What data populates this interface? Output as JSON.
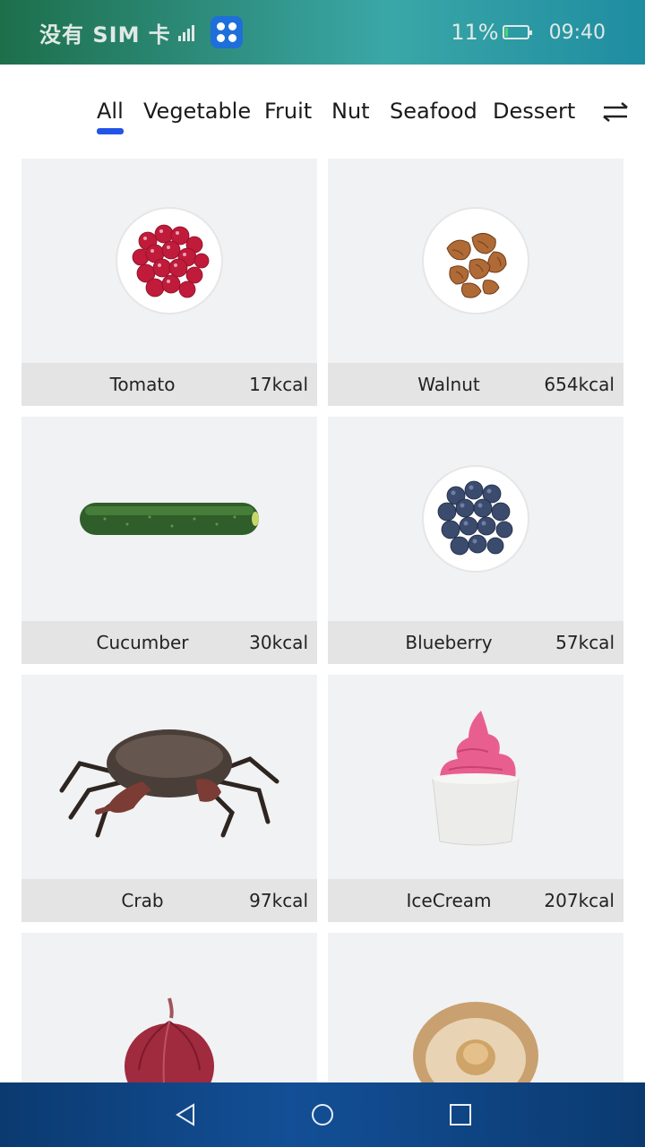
{
  "status_bar": {
    "carrier": "没有 SIM 卡",
    "battery": "11%",
    "battery_level": 0.11,
    "time": "09:40"
  },
  "tabs": [
    {
      "label": "All",
      "active": true
    },
    {
      "label": "Vegetable",
      "active": false
    },
    {
      "label": "Fruit",
      "active": false
    },
    {
      "label": "Nut",
      "active": false
    },
    {
      "label": "Seafood",
      "active": false
    },
    {
      "label": "Dessert",
      "active": false
    }
  ],
  "swap_icon": "swap-arrows-icon",
  "foods": [
    {
      "name": "Tomato",
      "kcal": "17kcal",
      "icon": "cranberry-bowl"
    },
    {
      "name": "Walnut",
      "kcal": "654kcal",
      "icon": "walnut-bowl"
    },
    {
      "name": "Cucumber",
      "kcal": "30kcal",
      "icon": "cucumber"
    },
    {
      "name": "Blueberry",
      "kcal": "57kcal",
      "icon": "blueberry-bowl"
    },
    {
      "name": "Crab",
      "kcal": "97kcal",
      "icon": "crab"
    },
    {
      "name": "IceCream",
      "kcal": "207kcal",
      "icon": "ice-cream"
    },
    {
      "name": "",
      "kcal": "",
      "icon": "onion"
    },
    {
      "name": "",
      "kcal": "",
      "icon": "mushroom"
    }
  ],
  "nav": {
    "back_icon": "back-triangle-icon",
    "home_icon": "home-circle-icon",
    "recents_icon": "recents-square-icon"
  },
  "colors": {
    "accent": "#2354e6",
    "card_bg": "#f1f2f4",
    "card_footer": "#e4e4e4"
  }
}
